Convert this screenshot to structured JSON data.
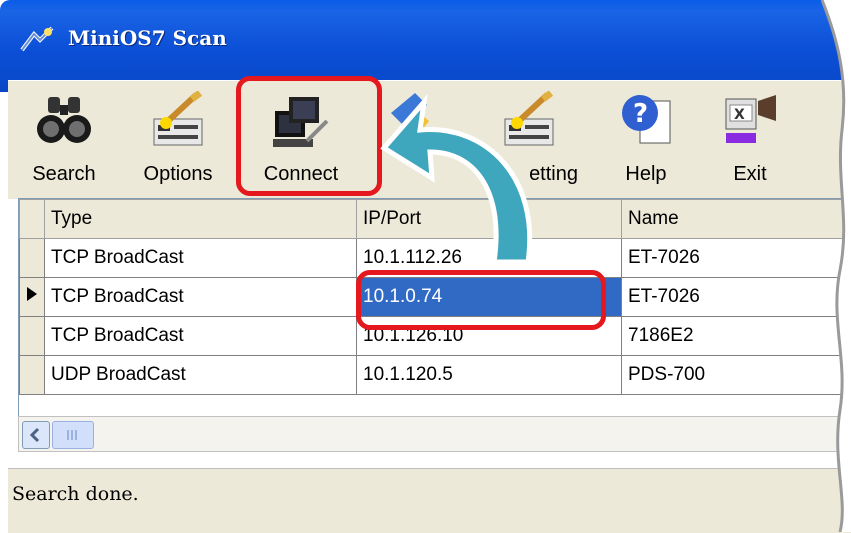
{
  "window": {
    "title": "MiniOS7 Scan"
  },
  "toolbar": {
    "buttons": [
      {
        "id": "search",
        "label": "Search",
        "icon": "binoculars-icon"
      },
      {
        "id": "options",
        "label": "Options",
        "icon": "options-wand-icon"
      },
      {
        "id": "connect",
        "label": "Connect",
        "icon": "computer-connect-icon"
      },
      {
        "id": "clear",
        "label": "",
        "icon": "broom-icon"
      },
      {
        "id": "ipsetting",
        "label": "etting",
        "icon": "ip-setting-icon"
      },
      {
        "id": "help",
        "label": "Help",
        "icon": "help-icon"
      },
      {
        "id": "exit",
        "label": "Exit",
        "icon": "exit-icon"
      }
    ]
  },
  "grid": {
    "columns": [
      "Type",
      "IP/Port",
      "Name"
    ],
    "rows": [
      {
        "type": "TCP BroadCast",
        "ip": "10.1.112.26",
        "name": "ET-7026",
        "selected": false
      },
      {
        "type": "TCP BroadCast",
        "ip": "10.1.0.74",
        "name": "ET-7026",
        "selected": true
      },
      {
        "type": "TCP BroadCast",
        "ip": "10.1.126.10",
        "name": "7186E2",
        "selected": false
      },
      {
        "type": "UDP BroadCast",
        "ip": "10.1.120.5",
        "name": "PDS-700",
        "selected": false
      }
    ]
  },
  "status": {
    "text": "Search done."
  },
  "colors": {
    "titlebar": "#0a4fd6",
    "highlight": "#e5181e",
    "arrow": "#3ea6bd",
    "selection": "#316ac5"
  }
}
